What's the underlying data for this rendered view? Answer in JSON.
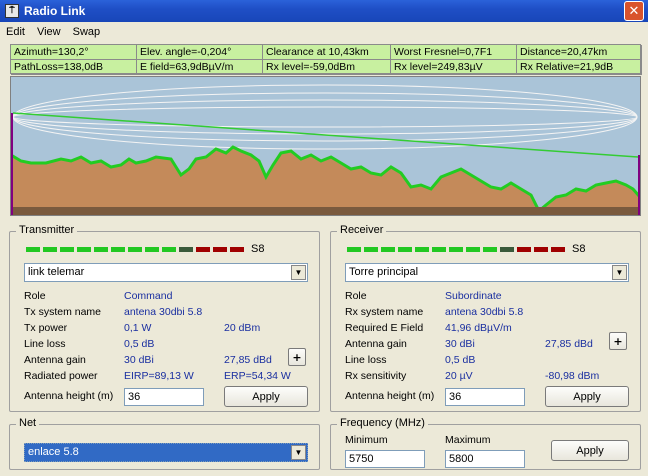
{
  "window": {
    "title": "Radio Link",
    "close": "✕"
  },
  "menu": [
    "Edit",
    "View",
    "Swap"
  ],
  "info": [
    "Azimuth=130,2°",
    "Elev. angle=-0,204°",
    "Clearance at 10,43km",
    "Worst Fresnel=0,7F1",
    "Distance=20,47km",
    "PathLoss=138,0dB",
    "E field=63,9dBµV/m",
    "Rx level=-59,0dBm",
    "Rx level=249,83µV",
    "Rx Relative=21,9dB"
  ],
  "colors": {
    "terrain": "#c48a5a",
    "terrain_top": "#22cc22",
    "sky": "#aac4d8",
    "los_line": "#33cc33",
    "meter_green": "#22c822",
    "meter_dark": "#3a5a3a",
    "meter_red": "#a00000"
  },
  "transmitter": {
    "label": "Transmitter",
    "meter_level": "S8",
    "meter_bars": {
      "lit_green": 9,
      "dark": 1,
      "red": 3
    },
    "site": "link telemar",
    "rows": [
      {
        "label": "Role",
        "value": "Command",
        "value2": ""
      },
      {
        "label": "Tx system name",
        "value": "antena 30dbi 5.8",
        "value2": ""
      },
      {
        "label": "Tx power",
        "value": "0,1 W",
        "value2": "20 dBm"
      },
      {
        "label": "Line loss",
        "value": "0,5 dB",
        "value2": ""
      },
      {
        "label": "Antenna gain",
        "value": "30 dBi",
        "value2": "27,85 dBd"
      },
      {
        "label": "Radiated power",
        "value": "EIRP=89,13 W",
        "value2": "ERP=54,34 W"
      }
    ],
    "antenna_height_label": "Antenna height (m)",
    "antenna_height": "36",
    "apply": "Apply",
    "plus": "+"
  },
  "receiver": {
    "label": "Receiver",
    "meter_level": "S8",
    "meter_bars": {
      "lit_green": 9,
      "dark": 1,
      "red": 3
    },
    "site": "Torre principal",
    "rows": [
      {
        "label": "Role",
        "value": "Subordinate",
        "value2": ""
      },
      {
        "label": "Rx system name",
        "value": "antena 30dbi 5.8",
        "value2": ""
      },
      {
        "label": "Required E Field",
        "value": "41,96 dBµV/m",
        "value2": ""
      },
      {
        "label": "Antenna gain",
        "value": "30 dBi",
        "value2": "27,85 dBd"
      },
      {
        "label": "Line loss",
        "value": "0,5 dB",
        "value2": ""
      },
      {
        "label": "Rx sensitivity",
        "value": "20 µV",
        "value2": "-80,98 dBm"
      }
    ],
    "antenna_height_label": "Antenna height (m)",
    "antenna_height": "36",
    "apply": "Apply",
    "plus": "+"
  },
  "net": {
    "label": "Net",
    "value": "enlace 5.8"
  },
  "frequency": {
    "label": "Frequency (MHz)",
    "min_label": "Minimum",
    "max_label": "Maximum",
    "min": "5750",
    "max": "5800",
    "apply": "Apply"
  }
}
